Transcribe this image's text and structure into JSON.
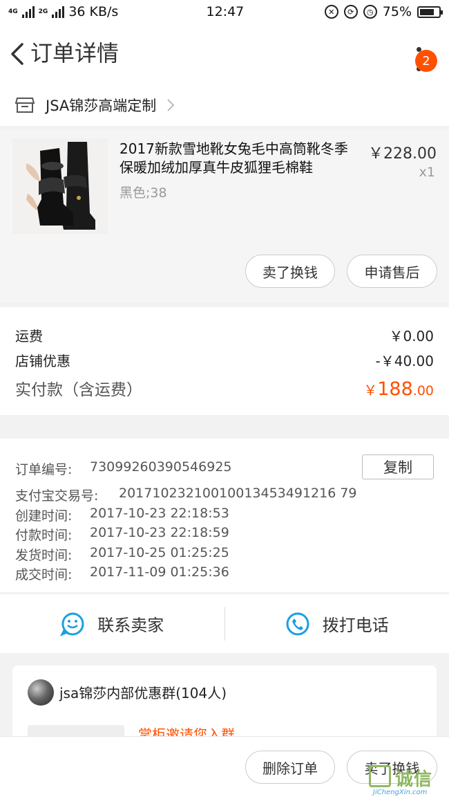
{
  "status_bar": {
    "network_4g": "4G",
    "network_2g": "2G",
    "speed": "36 KB/s",
    "time": "12:47",
    "battery": "75%",
    "battery_level": 0.75
  },
  "header": {
    "title": "订单详情",
    "badge_count": "2"
  },
  "shop": {
    "name": "JSA锦莎高端定制"
  },
  "item": {
    "title": "2017新款雪地靴女兔毛中高筒靴冬季保暖加绒加厚真牛皮狐狸毛棉鞋",
    "sku": "黑色;38",
    "price": "￥228.00",
    "qty": "x1",
    "btn_sell": "卖了换钱",
    "btn_aftersale": "申请售后"
  },
  "fees": {
    "shipping_label": "运费",
    "shipping_value": "￥0.00",
    "discount_label": "店铺优惠",
    "discount_value": "-￥40.00",
    "total_label": "实付款（含运费）",
    "total_yen": "￥",
    "total_int": "188",
    "total_dec": ".00"
  },
  "order_info": {
    "order_no_label": "订单编号:",
    "order_no": "73099260390546925",
    "copy_label": "复制",
    "alipay_label": "支付宝交易号:",
    "alipay_no": "20171023210010013453491216 79",
    "created_label": "创建时间:",
    "created": "2017-10-23 22:18:53",
    "paid_label": "付款时间:",
    "paid": "2017-10-23 22:18:59",
    "shipped_label": "发货时间:",
    "shipped": "2017-10-25 01:25:25",
    "done_label": "成交时间:",
    "done": "2017-11-09 01:25:36"
  },
  "contact": {
    "seller": "联系卖家",
    "call": "拨打电话"
  },
  "group": {
    "name": "jsa锦莎内部优惠群(104人)",
    "invite": "掌柜邀请您入群"
  },
  "bottom": {
    "delete": "删除订单",
    "sell": "卖了换钱"
  },
  "watermark": {
    "text": "诚信",
    "sub": "JiChengXin.com"
  },
  "colors": {
    "accent": "#ff5000",
    "contact_icon": "#1a9fe0"
  }
}
